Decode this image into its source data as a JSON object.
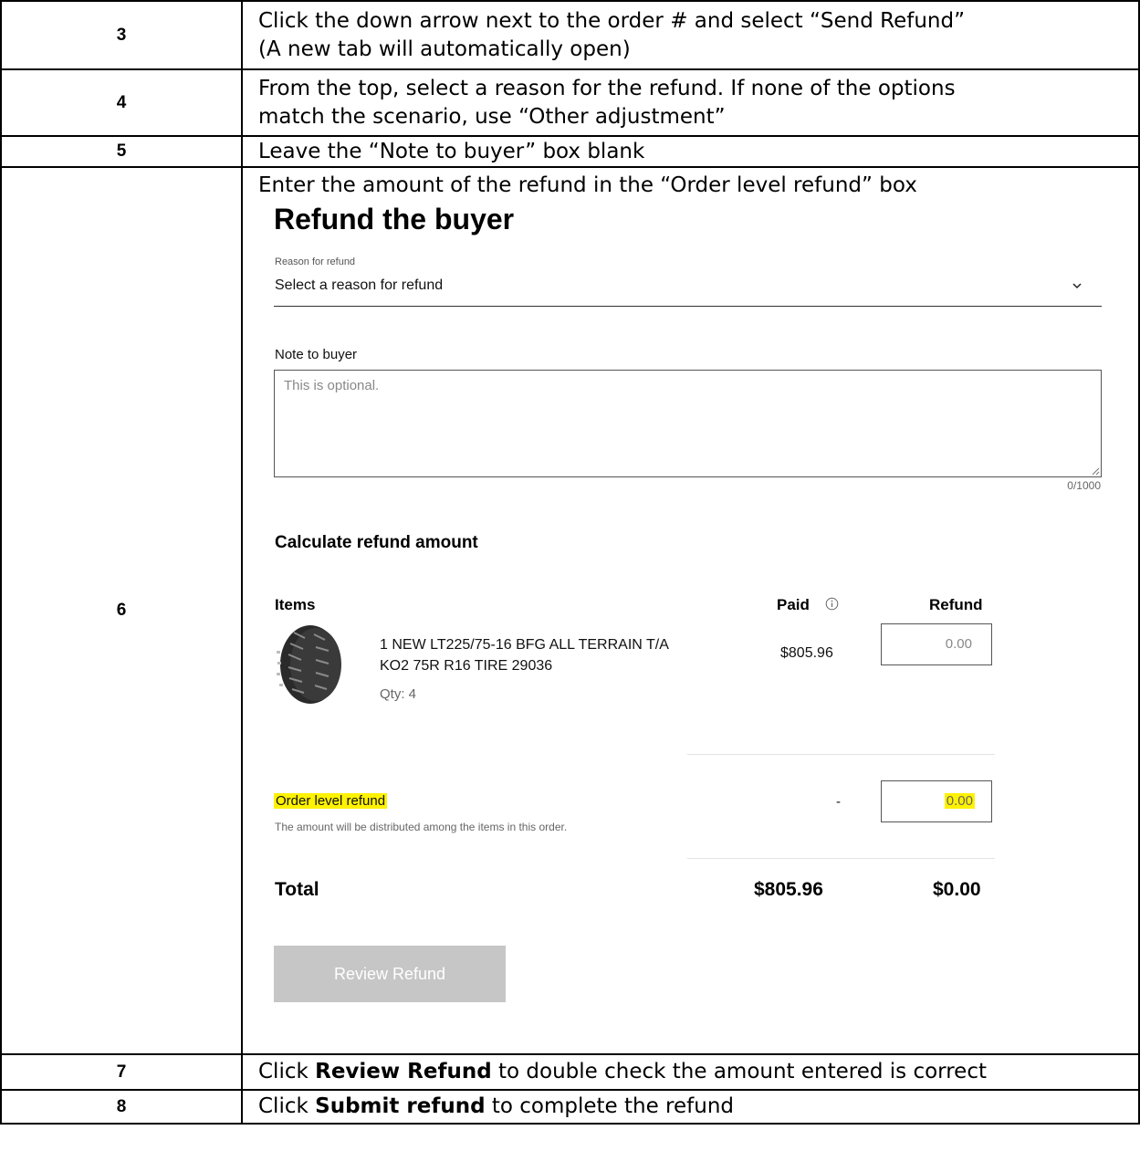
{
  "steps": [
    {
      "num": "3",
      "line1": "Click the down arrow next to the order # and select “Send Refund”",
      "line2": "(A new tab will automatically open)"
    },
    {
      "num": "4",
      "line1": "From the top, select a reason for the refund. If none of the options",
      "line2": "match the scenario, use “Other adjustment”"
    },
    {
      "num": "5",
      "line1": "Leave the “Note to buyer” box blank"
    },
    {
      "num": "6",
      "line1": "Enter the amount of the refund in the “Order level refund” box"
    },
    {
      "num": "7",
      "pre": "Click ",
      "bold": "Review Refund",
      "post": " to double check the amount entered is correct"
    },
    {
      "num": "8",
      "pre": "Click ",
      "bold": "Submit refund",
      "post": " to complete the refund"
    }
  ],
  "refund_form": {
    "title": "Refund the buyer",
    "reason_label": "Reason for refund",
    "reason_value": "Select a reason for refund",
    "note_label": "Note to buyer",
    "note_placeholder": "This is optional.",
    "char_count": "0/1000",
    "calc_heading": "Calculate refund amount",
    "col_items": "Items",
    "col_paid": "Paid",
    "col_refund": "Refund",
    "item": {
      "name": "1 NEW LT225/75-16 BFG ALL TERRAIN T/A KO2 75R R16 TIRE 29036",
      "qty": "Qty: 4",
      "paid": "$805.96",
      "refund": "0.00"
    },
    "order_level_label": "Order level refund",
    "order_level_desc": "The amount will be distributed among the items in this order.",
    "order_level_paid": "-",
    "order_level_refund": "0.00",
    "total_label": "Total",
    "total_paid": "$805.96",
    "total_refund": "$0.00",
    "review_button": "Review Refund"
  }
}
